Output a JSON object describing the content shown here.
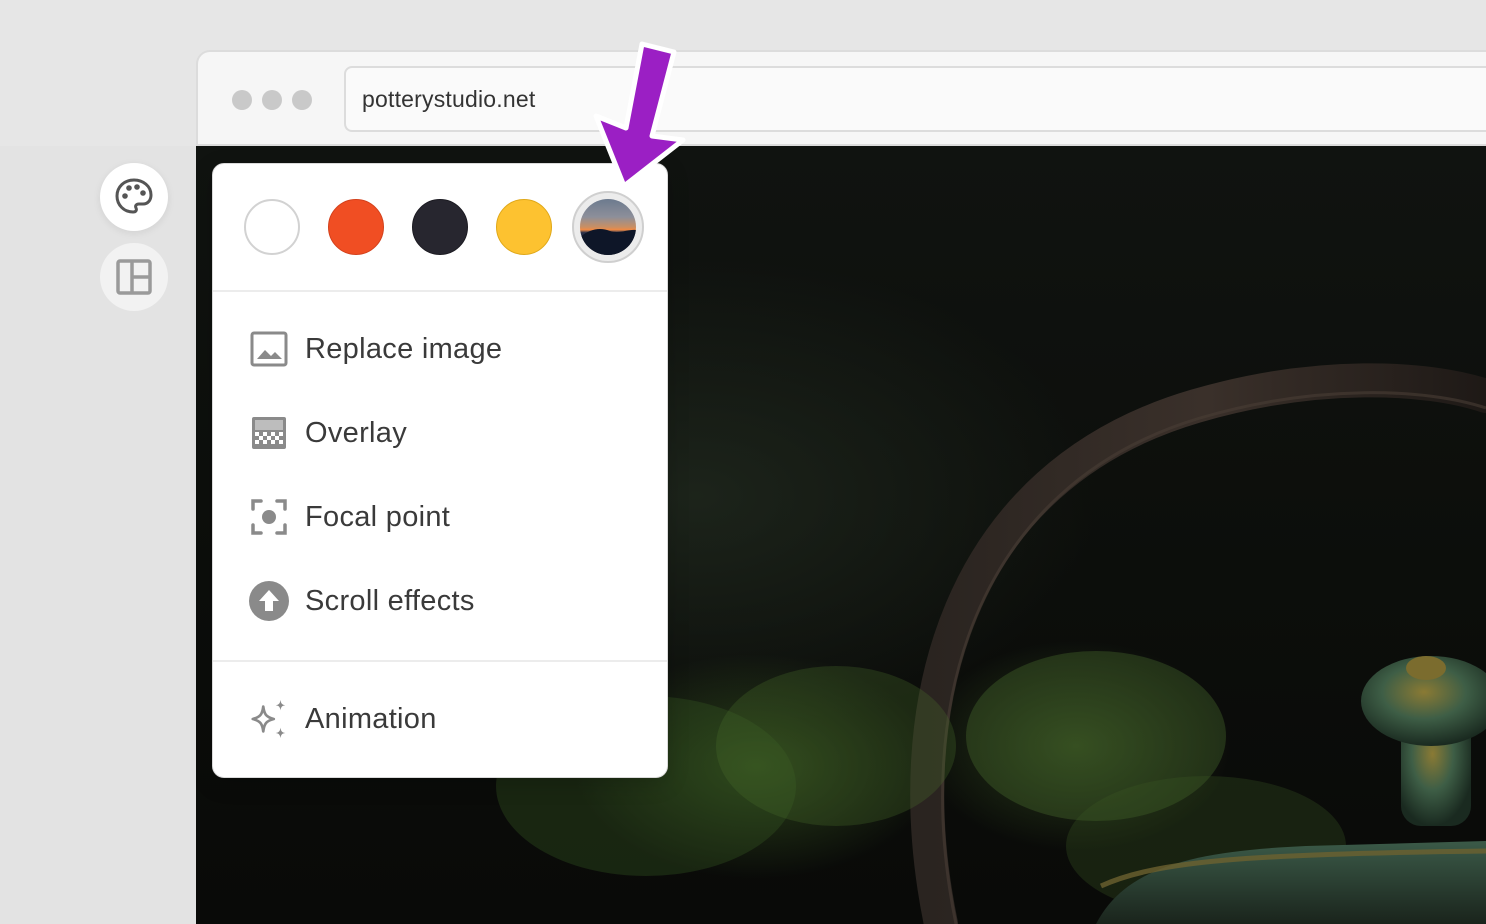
{
  "browser": {
    "url": "potterystudio.net"
  },
  "left_rail": {
    "items": [
      {
        "icon": "palette-icon",
        "active": true
      },
      {
        "icon": "layout-icon",
        "active": false
      }
    ]
  },
  "style_popover": {
    "swatches": [
      {
        "name": "white",
        "color": "#ffffff"
      },
      {
        "name": "orange",
        "color": "#f04e23"
      },
      {
        "name": "dark",
        "color": "#27262f"
      },
      {
        "name": "yellow",
        "color": "#fdc230"
      },
      {
        "name": "image",
        "selected": true
      }
    ],
    "menu": [
      {
        "label": "Replace image",
        "icon": "image-icon"
      },
      {
        "label": "Overlay",
        "icon": "overlay-icon"
      },
      {
        "label": "Focal point",
        "icon": "focal-point-icon"
      },
      {
        "label": "Scroll effects",
        "icon": "scroll-up-icon"
      }
    ],
    "footer_menu": [
      {
        "label": "Animation",
        "icon": "sparkle-icon"
      }
    ]
  },
  "annotation": {
    "arrow_color": "#9b1fc4"
  }
}
